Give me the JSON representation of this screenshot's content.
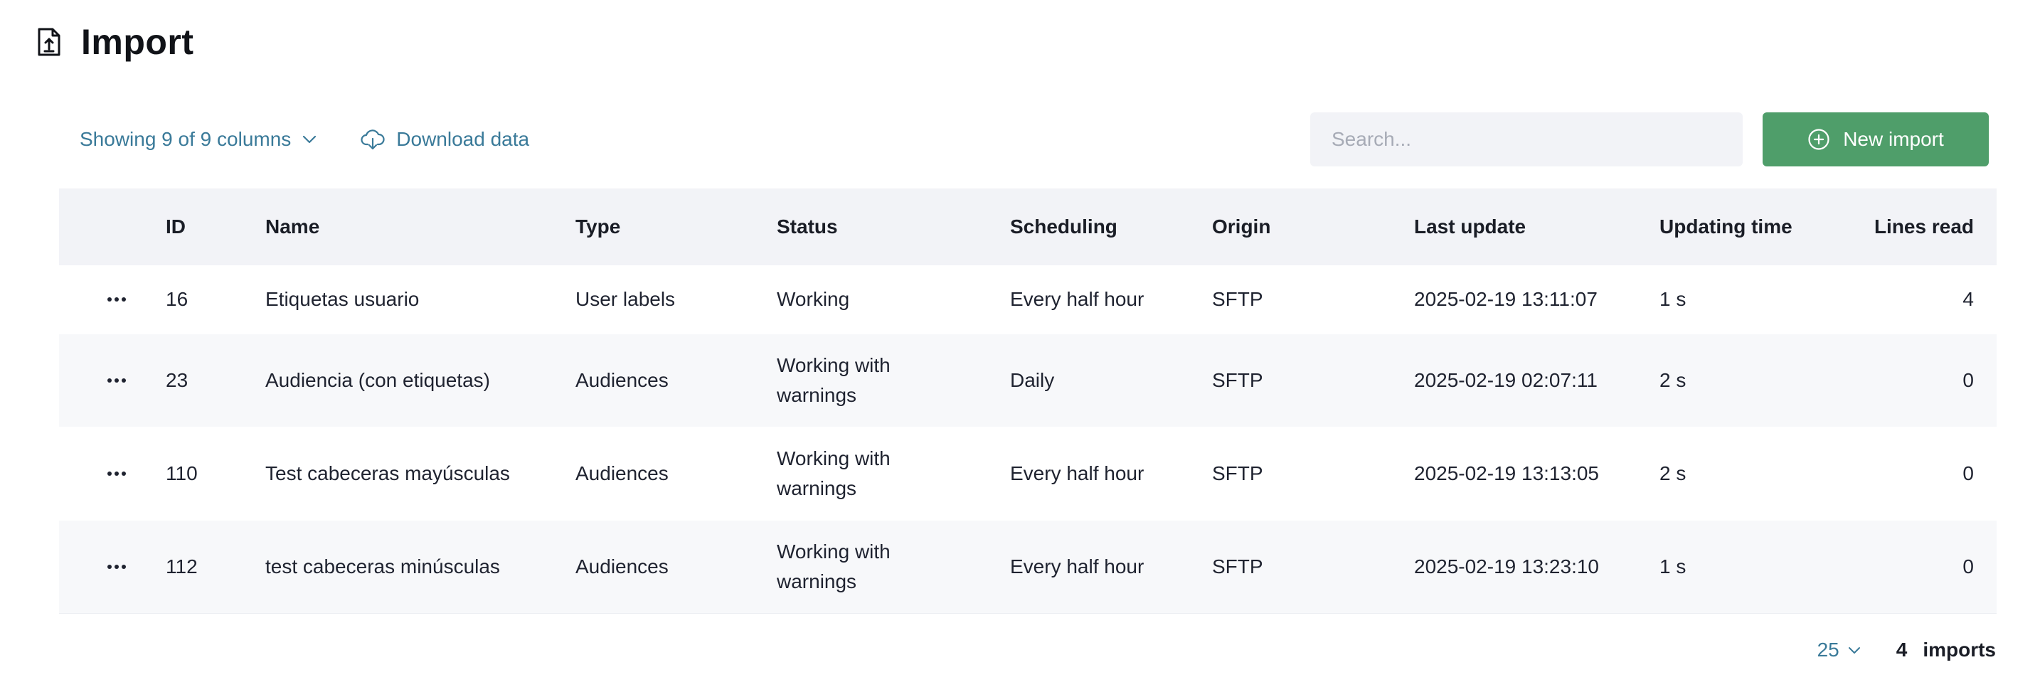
{
  "page": {
    "title": "Import",
    "icon": "file-upload-icon"
  },
  "toolbar": {
    "columns_label": "Showing 9 of 9 columns",
    "download_label": "Download data",
    "search_placeholder": "Search...",
    "search_value": "",
    "new_import_label": "New import"
  },
  "table": {
    "headers": {
      "id": "ID",
      "name": "Name",
      "type": "Type",
      "status": "Status",
      "scheduling": "Scheduling",
      "origin": "Origin",
      "last_update": "Last update",
      "updating_time": "Updating time",
      "lines_read": "Lines read"
    },
    "rows": [
      {
        "id": "16",
        "name": "Etiquetas usuario",
        "type": "User labels",
        "status_line1": "Working",
        "status_line2": "",
        "scheduling": "Every half hour",
        "origin": "SFTP",
        "last_update": "2025-02-19 13:11:07",
        "updating_time": "1 s",
        "lines_read": "4"
      },
      {
        "id": "23",
        "name": "Audiencia (con etiquetas)",
        "type": "Audiences",
        "status_line1": "Working with",
        "status_line2": "warnings",
        "scheduling": "Daily",
        "origin": "SFTP",
        "last_update": "2025-02-19 02:07:11",
        "updating_time": "2 s",
        "lines_read": "0"
      },
      {
        "id": "110",
        "name": "Test cabeceras mayúsculas",
        "type": "Audiences",
        "status_line1": "Working with",
        "status_line2": "warnings",
        "scheduling": "Every half hour",
        "origin": "SFTP",
        "last_update": "2025-02-19 13:13:05",
        "updating_time": "2 s",
        "lines_read": "0"
      },
      {
        "id": "112",
        "name": "test cabeceras minúsculas",
        "type": "Audiences",
        "status_line1": "Working with",
        "status_line2": "warnings",
        "scheduling": "Every half hour",
        "origin": "SFTP",
        "last_update": "2025-02-19 13:23:10",
        "updating_time": "1 s",
        "lines_read": "0"
      }
    ]
  },
  "footer": {
    "page_size": "25",
    "count": "4",
    "count_label": "imports"
  },
  "colors": {
    "accent_link": "#3a7a99",
    "primary_button": "#4f9e6a",
    "header_bg": "#f2f3f7",
    "row_alt_bg": "#f7f8fa"
  }
}
